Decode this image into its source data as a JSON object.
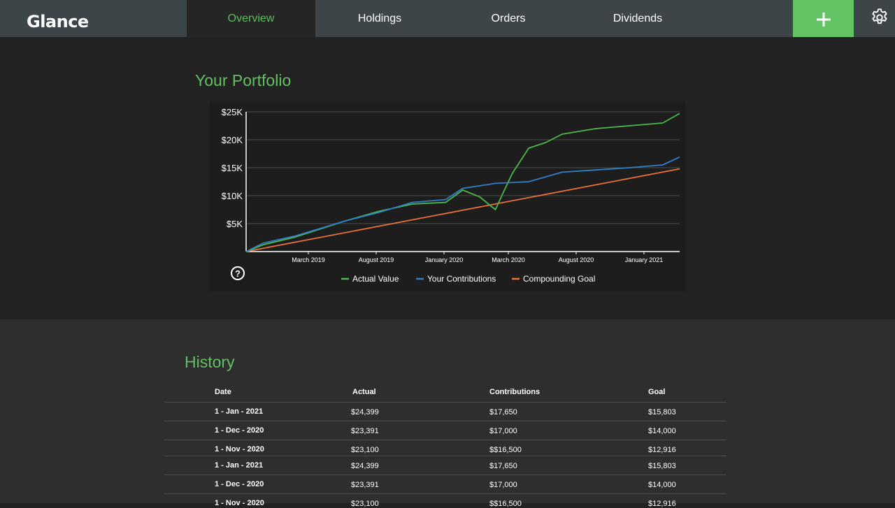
{
  "app": {
    "title": "Glance"
  },
  "nav": {
    "tabs": [
      {
        "label": "Overview",
        "active": true
      },
      {
        "label": "Holdings",
        "active": false
      },
      {
        "label": "Orders",
        "active": false
      },
      {
        "label": "Dividends",
        "active": false
      }
    ],
    "add_icon": "plus-icon",
    "settings_icon": "gear-icon"
  },
  "colors": {
    "accent": "#63c365",
    "actual": "#4cb84c",
    "contributions": "#2f7fc9",
    "goal": "#e8703a"
  },
  "portfolio": {
    "title": "Your Portfolio",
    "help_icon": "question-circle-icon"
  },
  "chart_data": {
    "type": "line",
    "y_ticks": [
      "$25K",
      "$20K",
      "$15K",
      "$10K",
      "$5K"
    ],
    "ylim": [
      0,
      25000
    ],
    "x_ticks": [
      "March 2019",
      "August 2019",
      "January 2020",
      "March 2020",
      "August 2020",
      "January 2021"
    ],
    "grid": true,
    "legend_position": "bottom",
    "series": [
      {
        "name": "Actual Value",
        "color": "#4cb84c",
        "x": [
          "2018-12",
          "2019-01",
          "2019-03",
          "2019-06",
          "2019-08",
          "2019-10",
          "2019-12",
          "2020-01",
          "2020-02",
          "2020-03",
          "2020-03-15",
          "2020-04",
          "2020-05",
          "2020-06",
          "2020-07",
          "2020-09",
          "2020-11",
          "2021-01",
          "2021-02"
        ],
        "values": [
          0,
          1200,
          2600,
          5500,
          7200,
          8500,
          8800,
          11000,
          9800,
          7500,
          10500,
          14000,
          18500,
          19500,
          21000,
          22000,
          22500,
          23000,
          24700
        ]
      },
      {
        "name": "Your Contributions",
        "color": "#2f7fc9",
        "x": [
          "2018-12",
          "2019-01",
          "2019-03",
          "2019-06",
          "2019-08",
          "2019-10",
          "2019-12",
          "2020-01",
          "2020-03",
          "2020-05",
          "2020-07",
          "2020-09",
          "2020-11",
          "2021-01",
          "2021-02"
        ],
        "values": [
          0,
          1500,
          2800,
          5500,
          7000,
          8800,
          9300,
          11300,
          12200,
          12500,
          14200,
          14600,
          15000,
          15500,
          16900
        ]
      },
      {
        "name": "Compounding Goal",
        "color": "#e8703a",
        "x": [
          "2018-12",
          "2021-02"
        ],
        "values": [
          0,
          14800
        ]
      }
    ]
  },
  "history": {
    "title": "History",
    "columns": [
      "Date",
      "Actual",
      "Contributions",
      "Goal"
    ],
    "rows": [
      {
        "date": "1 - Jan - 2021",
        "actual": "$24,399",
        "contributions": "$17,650",
        "goal": "$15,803"
      },
      {
        "date": "1 - Dec - 2020",
        "actual": "$23,391",
        "contributions": "$17,000",
        "goal": "$14,000"
      },
      {
        "date": "1 - Nov - 2020",
        "actual": "$23,100",
        "contributions": "$$16,500",
        "goal": "$12,916"
      },
      {
        "date": "1 - Jan - 2021",
        "actual": "$24,399",
        "contributions": "$17,650",
        "goal": "$15,803"
      },
      {
        "date": "1 - Dec - 2020",
        "actual": "$23,391",
        "contributions": "$17,000",
        "goal": "$14,000"
      },
      {
        "date": "1 - Nov - 2020",
        "actual": "$23,100",
        "contributions": "$$16,500",
        "goal": "$12,916"
      }
    ]
  }
}
